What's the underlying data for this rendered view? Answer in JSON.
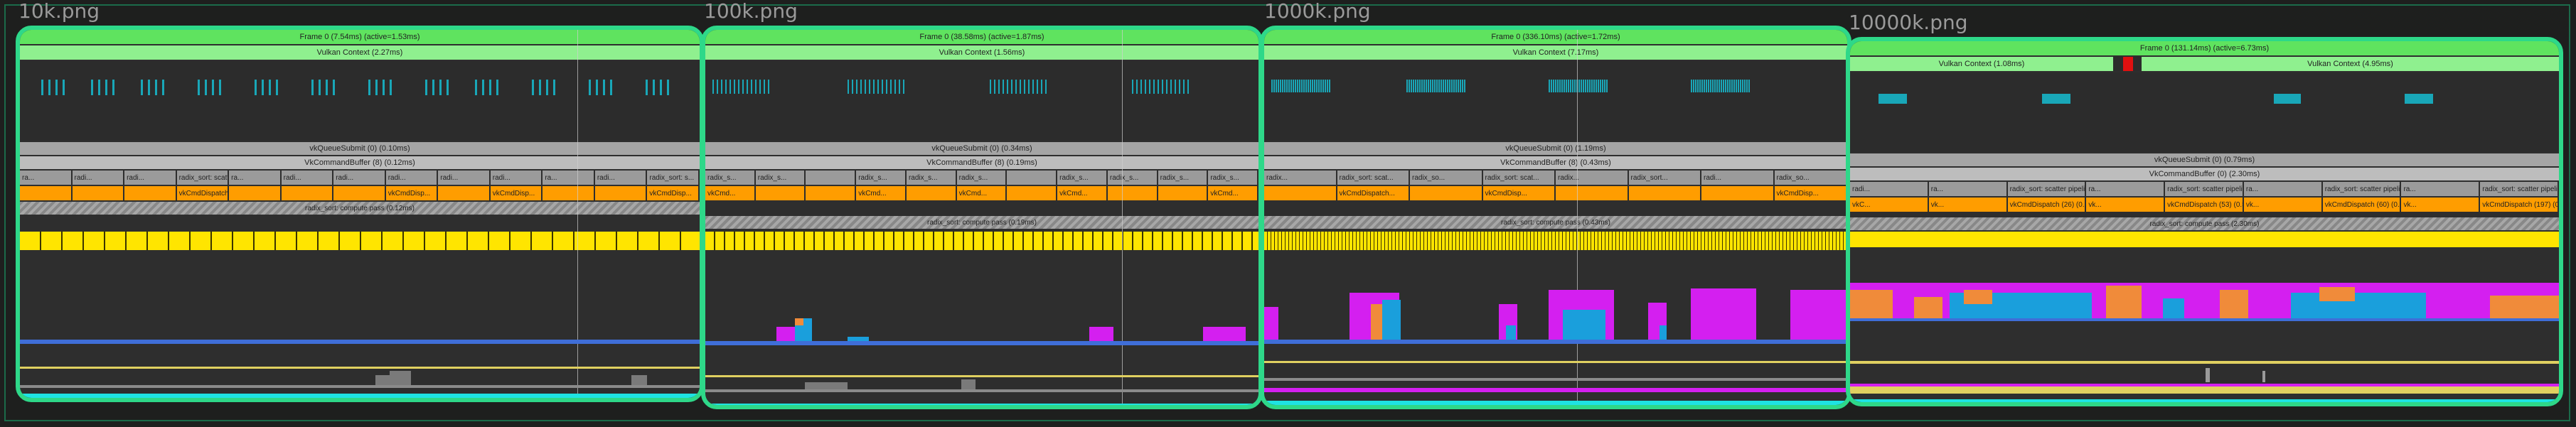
{
  "panels": [
    {
      "title": "10k.png",
      "frame": "Frame 0 (7.54ms) (active=1.53ms)",
      "vulkan": "Vulkan Context (2.27ms)",
      "queue_submit": "vkQueueSubmit (0) (0.10ms)",
      "command_buffer": "VkCommandBuffer (8) (0.12ms)",
      "scatter_label": "radix_sort: scatter pipeline",
      "dispatch_label": "vkCmdDispatch (6)",
      "hatch_label": "radix_sort: compute pass (0.12ms)",
      "gray_slices": [
        "ra...",
        "radi...",
        "radi...",
        "radix_sort: scatter ...",
        "ra...",
        "radi...",
        "radi...",
        "radi...",
        "radi...",
        "radi...",
        "ra...",
        "radi...",
        "radix_sort: s..."
      ],
      "orange_slices": [
        "",
        "",
        "",
        "vkCmdDispatch (6)...",
        "",
        "",
        "",
        "vkCmdDisp...",
        "",
        "vkCmdDisp...",
        "",
        "",
        "vkCmdDisp..."
      ]
    },
    {
      "title": "100k.png",
      "frame": "Frame 0 (38.58ms) (active=1.87ms)",
      "vulkan": "Vulkan Context (1.56ms)",
      "queue_submit": "vkQueueSubmit (0) (0.34ms)",
      "command_buffer": "VkCommandBuffer (8) (0.19ms)",
      "scatter_label": "radix_s...",
      "dispatch_label": "vkCmd...",
      "hatch_label": "radix_sort: compute pass (0.19ms)",
      "gray_slices": [
        "radix_s...",
        "radix_s...",
        "",
        "radix_s...",
        "radix_s...",
        "radix_s...",
        "",
        "radix_s...",
        "radix_s...",
        "radix_s...",
        "radix_s..."
      ],
      "orange_slices": [
        "vkCmd...",
        "",
        "",
        "vkCmd...",
        "",
        "vkCmd...",
        "",
        "vkCmd...",
        "",
        "",
        "vkCmd..."
      ]
    },
    {
      "title": "1000k.png",
      "frame": "Frame 0 (336.10ms) (active=1.72ms)",
      "vulkan": "Vulkan Context (7.17ms)",
      "queue_submit": "vkQueueSubmit (0) (1.19ms)",
      "command_buffer": "VkCommandBuffer (8) (0.43ms)",
      "scatter_label": "radix_sort: scat...",
      "dispatch_label": "vkCmdDispatch...",
      "hatch_label": "radix_sort: compute pass (0.43ms)",
      "gray_slices": [
        "radix...",
        "radix_sort: scat...",
        "radix_so...",
        "radix_sort: scat...",
        "radix...",
        "radix_sort...",
        "radi...",
        "radix_so..."
      ],
      "orange_slices": [
        "",
        "vkCmdDispatch...",
        "",
        "vkCmdDisp...",
        "",
        "",
        "",
        "vkCmdDisp..."
      ]
    },
    {
      "title": "10000k.png",
      "frame": "Frame 0 (131.14ms) (active=6.73ms)",
      "vulkan_left": "Vulkan Context (1.08ms)",
      "vulkan_right": "Vulkan Context (4.95ms)",
      "queue_submit": "vkQueueSubmit (0) (0.79ms)",
      "command_buffer": "VkCommandBuffer (0) (2.30ms)",
      "hatch_label": "radix_sort: compute pass (2.30ms)",
      "gray_slices": [
        "radi...",
        "ra...",
        "radix_sort: scatter pipeline",
        "ra...",
        "radix_sort: scatter pipeline | VkPipeline (0.57ms)",
        "ra...",
        "radix_sort: scatter pipeline",
        "ra...",
        "radix_sort: scatter pipeline"
      ],
      "orange_slices": [
        "vkC...",
        "vk...",
        "vkCmdDispatch (26) (0.38ms)",
        "vk...",
        "vkCmdDispatch (53) (0.57ms)",
        "vk...",
        "vkCmdDispatch (60) (0.38...",
        "vk...",
        "vkCmdDispatch (197) (0.5..."
      ]
    }
  ],
  "colors": {
    "panel_border": "#2ed889",
    "frame_bar": "#5fe35f",
    "vulkan_bar": "#8ff08f",
    "dispatch": "#ff9d00",
    "compute": "#ffe500",
    "counter_magenta": "#d41ff0",
    "counter_blue": "#1a9fdc",
    "counter_orange": "#f08b3a",
    "counter_cyan": "#1ee3e3"
  }
}
